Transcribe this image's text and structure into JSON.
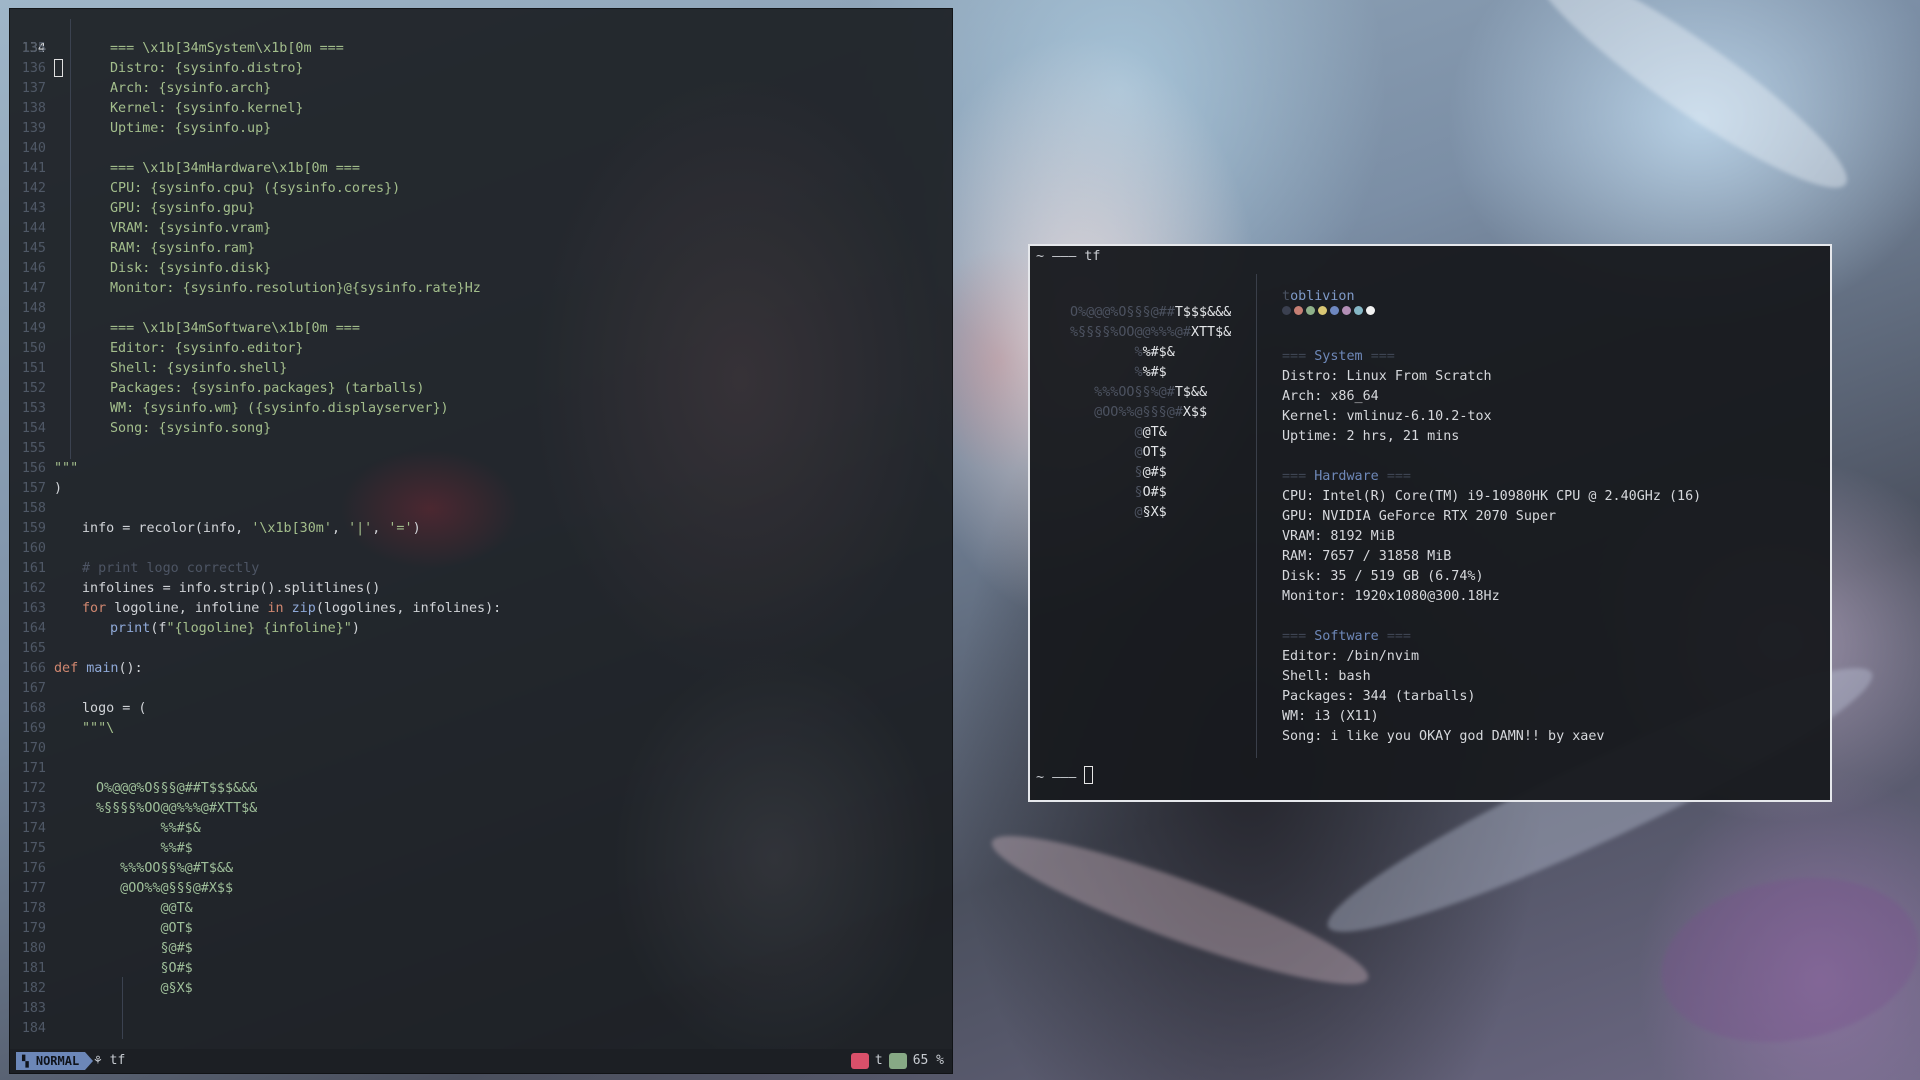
{
  "colors": {
    "mode_bg": "#6c87b8",
    "string": "#a3be8c",
    "keyword": "#d08770",
    "function": "#8fa9d8",
    "header": "#6e88b8",
    "terminal_border": "#e6e8ec"
  },
  "editor": {
    "current_line": "134",
    "lines": [
      {
        "n": "135",
        "indent": 4,
        "parts": [
          {
            "t": "=== \\x1b[34mSystem\\x1b[0m ===",
            "c": "str"
          }
        ]
      },
      {
        "n": "136",
        "indent": 4,
        "parts": [
          {
            "t": "Distro: {sysinfo.distro}",
            "c": "str"
          }
        ]
      },
      {
        "n": "137",
        "indent": 4,
        "parts": [
          {
            "t": "Arch: {sysinfo.arch}",
            "c": "str"
          }
        ]
      },
      {
        "n": "138",
        "indent": 4,
        "parts": [
          {
            "t": "Kernel: {sysinfo.kernel}",
            "c": "str"
          }
        ]
      },
      {
        "n": "139",
        "indent": 4,
        "parts": [
          {
            "t": "Uptime: {sysinfo.up}",
            "c": "str"
          }
        ]
      },
      {
        "n": "140",
        "indent": 0,
        "parts": []
      },
      {
        "n": "141",
        "indent": 4,
        "parts": [
          {
            "t": "=== \\x1b[34mHardware\\x1b[0m ===",
            "c": "str"
          }
        ]
      },
      {
        "n": "142",
        "indent": 4,
        "parts": [
          {
            "t": "CPU: {sysinfo.cpu} ({sysinfo.cores})",
            "c": "str"
          }
        ]
      },
      {
        "n": "143",
        "indent": 4,
        "parts": [
          {
            "t": "GPU: {sysinfo.gpu}",
            "c": "str"
          }
        ]
      },
      {
        "n": "144",
        "indent": 4,
        "parts": [
          {
            "t": "VRAM: {sysinfo.vram}",
            "c": "str"
          }
        ]
      },
      {
        "n": "145",
        "indent": 4,
        "parts": [
          {
            "t": "RAM: {sysinfo.ram}",
            "c": "str"
          }
        ]
      },
      {
        "n": "146",
        "indent": 4,
        "parts": [
          {
            "t": "Disk: {sysinfo.disk}",
            "c": "str"
          }
        ]
      },
      {
        "n": "147",
        "indent": 4,
        "parts": [
          {
            "t": "Monitor: {sysinfo.resolution}@{sysinfo.rate}Hz",
            "c": "str"
          }
        ]
      },
      {
        "n": "148",
        "indent": 0,
        "parts": []
      },
      {
        "n": "149",
        "indent": 4,
        "parts": [
          {
            "t": "=== \\x1b[34mSoftware\\x1b[0m ===",
            "c": "str"
          }
        ]
      },
      {
        "n": "150",
        "indent": 4,
        "parts": [
          {
            "t": "Editor: {sysinfo.editor}",
            "c": "str"
          }
        ]
      },
      {
        "n": "151",
        "indent": 4,
        "parts": [
          {
            "t": "Shell: {sysinfo.shell}",
            "c": "str"
          }
        ]
      },
      {
        "n": "152",
        "indent": 4,
        "parts": [
          {
            "t": "Packages: {sysinfo.packages} (tarballs)",
            "c": "str"
          }
        ]
      },
      {
        "n": "153",
        "indent": 4,
        "parts": [
          {
            "t": "WM: {sysinfo.wm} ({sysinfo.displayserver})",
            "c": "str"
          }
        ]
      },
      {
        "n": "154",
        "indent": 4,
        "parts": [
          {
            "t": "Song: {sysinfo.song}",
            "c": "str"
          }
        ]
      },
      {
        "n": "155",
        "indent": 0,
        "parts": []
      },
      {
        "n": "156",
        "indent": 0,
        "parts": [
          {
            "t": "\"\"\"",
            "c": "str"
          }
        ]
      },
      {
        "n": "157",
        "indent": 0,
        "parts": [
          {
            "t": ")",
            "c": "plain"
          }
        ]
      },
      {
        "n": "158",
        "indent": 0,
        "parts": []
      },
      {
        "n": "159",
        "indent": 2,
        "parts": [
          {
            "t": "info = recolor(info, ",
            "c": "plain"
          },
          {
            "t": "'\\x1b[30m'",
            "c": "str"
          },
          {
            "t": ", ",
            "c": "plain"
          },
          {
            "t": "'|'",
            "c": "str"
          },
          {
            "t": ", ",
            "c": "plain"
          },
          {
            "t": "'='",
            "c": "str"
          },
          {
            "t": ")",
            "c": "plain"
          }
        ]
      },
      {
        "n": "160",
        "indent": 0,
        "parts": []
      },
      {
        "n": "161",
        "indent": 2,
        "parts": [
          {
            "t": "# print logo correctly",
            "c": "cm"
          }
        ]
      },
      {
        "n": "162",
        "indent": 2,
        "parts": [
          {
            "t": "infolines = info.strip().splitlines()",
            "c": "plain"
          }
        ]
      },
      {
        "n": "163",
        "indent": 2,
        "parts": [
          {
            "t": "for",
            "c": "kw"
          },
          {
            "t": " logoline, infoline ",
            "c": "plain"
          },
          {
            "t": "in",
            "c": "kw"
          },
          {
            "t": " ",
            "c": "plain"
          },
          {
            "t": "zip",
            "c": "fn"
          },
          {
            "t": "(logolines, infolines):",
            "c": "plain"
          }
        ]
      },
      {
        "n": "164",
        "indent": 4,
        "parts": [
          {
            "t": "print",
            "c": "fn"
          },
          {
            "t": "(f",
            "c": "plain"
          },
          {
            "t": "\"{logoline} {infoline}\"",
            "c": "str"
          },
          {
            "t": ")",
            "c": "plain"
          }
        ]
      },
      {
        "n": "165",
        "indent": 0,
        "parts": []
      },
      {
        "n": "166",
        "indent": 0,
        "parts": [
          {
            "t": "def",
            "c": "kw"
          },
          {
            "t": " ",
            "c": "plain"
          },
          {
            "t": "main",
            "c": "fn"
          },
          {
            "t": "():",
            "c": "plain"
          }
        ]
      },
      {
        "n": "167",
        "indent": 0,
        "parts": []
      },
      {
        "n": "168",
        "indent": 2,
        "parts": [
          {
            "t": "logo = (",
            "c": "plain"
          }
        ]
      },
      {
        "n": "169",
        "indent": 2,
        "parts": [
          {
            "t": "\"\"\"\\",
            "c": "str"
          }
        ]
      },
      {
        "n": "170",
        "indent": 0,
        "parts": []
      },
      {
        "n": "171",
        "indent": 0,
        "parts": []
      },
      {
        "n": "172",
        "indent": 3,
        "parts": [
          {
            "t": "O%@@@%O§§§@##T$$$&&&",
            "c": "lg"
          }
        ]
      },
      {
        "n": "173",
        "indent": 3,
        "parts": [
          {
            "t": "%§§§§%OO@@%%%@#XTT$&",
            "c": "lg"
          }
        ]
      },
      {
        "n": "174",
        "indent": 3,
        "parts": [
          {
            "t": "        %%#$&",
            "c": "lg"
          }
        ]
      },
      {
        "n": "175",
        "indent": 3,
        "parts": [
          {
            "t": "        %%#$",
            "c": "lg"
          }
        ]
      },
      {
        "n": "176",
        "indent": 3,
        "parts": [
          {
            "t": "   %%%OO§§%@#T$&&",
            "c": "lg"
          }
        ]
      },
      {
        "n": "177",
        "indent": 3,
        "parts": [
          {
            "t": "   @OO%%@§§§@#X$$",
            "c": "lg"
          }
        ]
      },
      {
        "n": "178",
        "indent": 3,
        "parts": [
          {
            "t": "        @@T&",
            "c": "lg"
          }
        ]
      },
      {
        "n": "179",
        "indent": 3,
        "parts": [
          {
            "t": "        @OT$",
            "c": "lg"
          }
        ]
      },
      {
        "n": "180",
        "indent": 3,
        "parts": [
          {
            "t": "        §@#$",
            "c": "lg"
          }
        ]
      },
      {
        "n": "181",
        "indent": 3,
        "parts": [
          {
            "t": "        §O#$",
            "c": "lg"
          }
        ]
      },
      {
        "n": "182",
        "indent": 3,
        "parts": [
          {
            "t": "        @§X$",
            "c": "lg"
          }
        ]
      },
      {
        "n": "183",
        "indent": 0,
        "parts": []
      },
      {
        "n": "184",
        "indent": 0,
        "parts": []
      }
    ],
    "status": {
      "mode": "NORMAL",
      "mode_icon": "vim-icon",
      "file": "tf",
      "file_icon": "python-icon",
      "filetype_letter": "t",
      "percent": "65 %"
    }
  },
  "terminal": {
    "title_prompt": "~ ——— tf",
    "bottom_prompt": "~ ———",
    "logo": [
      {
        "dim": "O%@@@%O§§§@##",
        "bright": "T$$$&&&"
      },
      {
        "dim": "%§§§§%OO@@%%%@#",
        "bright": "XTT$&"
      },
      {
        "dim": "        %",
        "bright": "%#$&"
      },
      {
        "dim": "        %",
        "bright": "%#$"
      },
      {
        "dim": "   %%%OO§§%@#",
        "bright": "T$&&"
      },
      {
        "dim": "   @OO%%@§§§@#",
        "bright": "X$$"
      },
      {
        "dim": "        @",
        "bright": "@T&"
      },
      {
        "dim": "        @",
        "bright": "OT$"
      },
      {
        "dim": "        §",
        "bright": "@#$"
      },
      {
        "dim": "        §",
        "bright": "O#$"
      },
      {
        "dim": "        @",
        "bright": "§X$"
      }
    ],
    "user_first": "t",
    "user_rest": "oblivion",
    "palette": [
      "#3b4050",
      "#c67f74",
      "#8fb18a",
      "#d9c774",
      "#6e88c0",
      "#b38fb6",
      "#85b7c6",
      "#f2f2f2"
    ],
    "info": {
      "system_header": "System",
      "distro": "Distro: Linux From Scratch",
      "arch": "Arch: x86_64",
      "kernel": "Kernel: vmlinuz-6.10.2-tox",
      "uptime": "Uptime: 2 hrs, 21 mins",
      "hardware_header": "Hardware",
      "cpu": "CPU: Intel(R) Core(TM) i9-10980HK CPU @ 2.40GHz (16)",
      "gpu": "GPU: NVIDIA GeForce RTX 2070 Super",
      "vram": "VRAM: 8192 MiB",
      "ram": "RAM: 7657 / 31858 MiB",
      "disk": "Disk: 35 / 519 GB (6.74%)",
      "monitor": "Monitor: 1920x1080@300.18Hz",
      "software_header": "Software",
      "editor": "Editor: /bin/nvim",
      "shell": "Shell: bash",
      "packages": "Packages: 344 (tarballs)",
      "wm": "WM: i3 (X11)",
      "song": "Song: i like you OKAY god DAMN!! by xaev",
      "eq": "==="
    }
  }
}
